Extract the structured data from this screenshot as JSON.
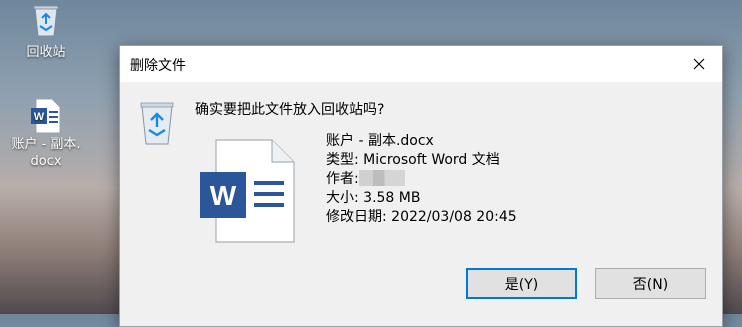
{
  "desktop": {
    "recycle_bin_label": "回收站",
    "doc_label_line1": "账户 - 副本.",
    "doc_label_line2": "docx"
  },
  "dialog": {
    "title": "删除文件",
    "question": "确实要把此文件放入回收站吗?",
    "file_name": "账户 - 副本.docx",
    "type_line": "类型: Microsoft Word 文档",
    "author_label": "作者:",
    "size_line": "大小: 3.58 MB",
    "modified_line": "修改日期: 2022/03/08 20:45",
    "yes_label": "是(Y)",
    "no_label": "否(N)"
  },
  "colors": {
    "accent": "#0078d7",
    "word_blue": "#2b579a"
  }
}
